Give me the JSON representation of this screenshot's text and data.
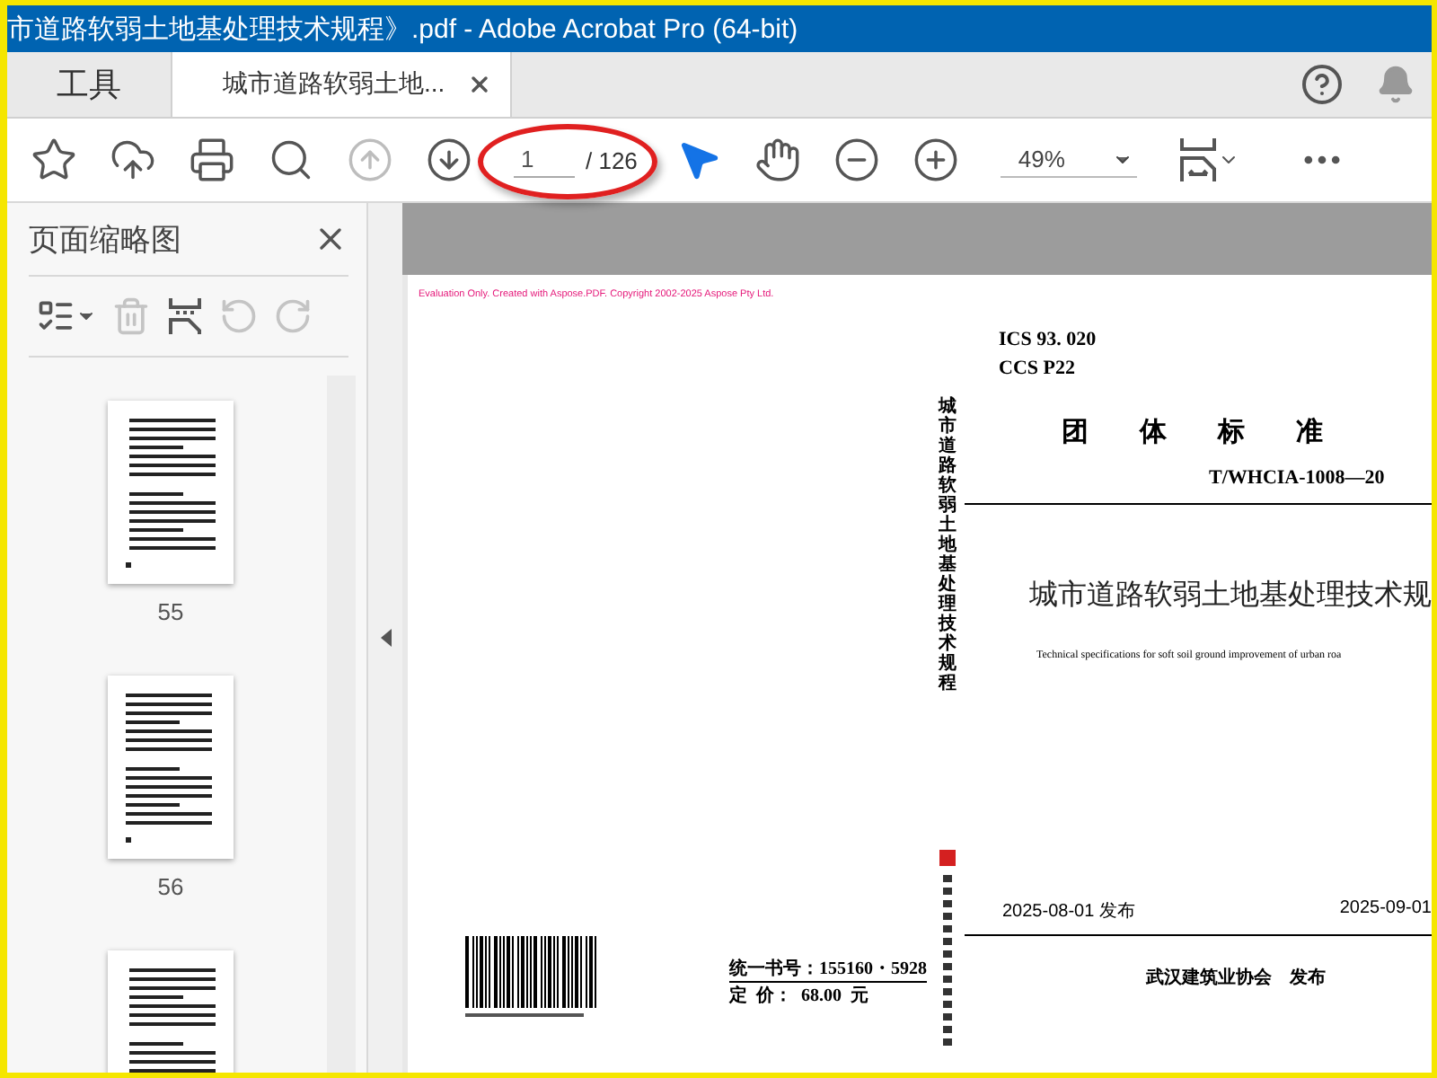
{
  "window": {
    "title": "市道路软弱土地基处理技术规程》.pdf - Adobe Acrobat Pro (64-bit)"
  },
  "tabs": [
    {
      "label": "工具",
      "selected": false,
      "kind": "home"
    },
    {
      "label": "城市道路软弱土地...",
      "selected": true,
      "kind": "document"
    }
  ],
  "toolbar": {
    "tools": [
      {
        "kind": "star",
        "disabled": false
      },
      {
        "kind": "upload",
        "disabled": false
      },
      {
        "kind": "print",
        "disabled": false
      },
      {
        "kind": "search",
        "disabled": false
      },
      {
        "kind": "prev",
        "disabled": true
      },
      {
        "kind": "next",
        "disabled": false
      }
    ],
    "page_nav": {
      "current": "1",
      "total": "/ 126",
      "highlighted": true
    },
    "modes": [
      {
        "kind": "pointer",
        "selected": true
      },
      {
        "kind": "hand",
        "selected": false
      }
    ],
    "zoom_tools": [
      {
        "kind": "zoom-out"
      },
      {
        "kind": "zoom-in"
      }
    ],
    "zoom": {
      "value": "49%"
    }
  },
  "thumbnails_panel": {
    "title": "页面缩略图",
    "tools": [
      {
        "kind": "options",
        "disabled": false
      },
      {
        "kind": "delete",
        "disabled": true
      },
      {
        "kind": "insert",
        "disabled": false
      },
      {
        "kind": "rotate-left",
        "disabled": true
      },
      {
        "kind": "rotate-right",
        "disabled": true
      }
    ],
    "thumbnails": [
      {
        "label": "55",
        "cut_off": false
      },
      {
        "label": "56",
        "cut_off": false
      },
      {
        "cut_off": true
      }
    ]
  },
  "document": {
    "evaluation_notice": "Evaluation Only. Created with Aspose.PDF. Copyright 2002-2025 Aspose Pty Ltd.",
    "spine_title": "城市道路软弱土地基处理技术规程",
    "book_number": "统一书号：155160・5928",
    "price": "定  价：  68.00  元",
    "ics": "ICS 93. 020",
    "ccs": "CCS P22",
    "category": "团体标准",
    "code": "T/WHCIA-1008—20",
    "title": "城市道路软弱土地基处理技术规",
    "english_title": "Technical specifications for soft soil ground improvement of urban roa",
    "issue_date": "2025-08-01 发布",
    "effective_date": "2025-09-01",
    "publisher": "武汉建筑业协会　发布"
  }
}
